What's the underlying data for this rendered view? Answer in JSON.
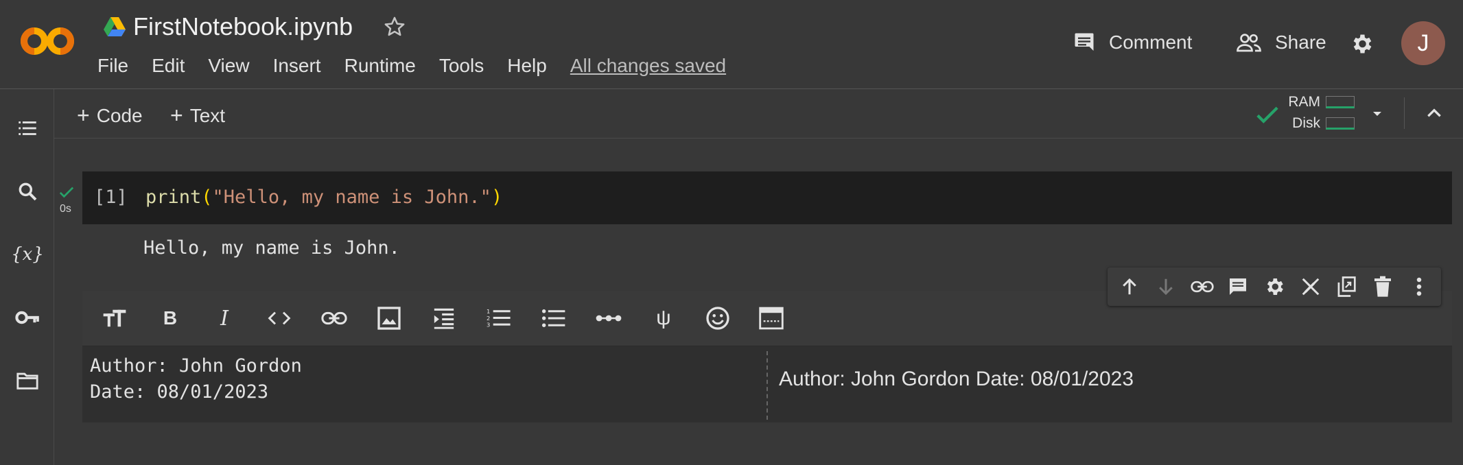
{
  "header": {
    "title": "FirstNotebook.ipynb",
    "menu": [
      "File",
      "Edit",
      "View",
      "Insert",
      "Runtime",
      "Tools",
      "Help"
    ],
    "saved_status": "All changes saved",
    "comment_label": "Comment",
    "share_label": "Share",
    "avatar_initial": "J"
  },
  "toolbar": {
    "code_label": "Code",
    "text_label": "Text",
    "ram_label": "RAM",
    "disk_label": "Disk"
  },
  "code_cell": {
    "exec_count": "[1]",
    "run_time": "0s",
    "code_func": "print",
    "code_open": "(",
    "code_string": "\"Hello, my name is John.\"",
    "code_close": ")",
    "output": "Hello, my name is John."
  },
  "text_cell": {
    "editor_lines": [
      "Author: John Gordon",
      "Date: 08/01/2023"
    ],
    "preview": "Author: John Gordon Date: 08/01/2023"
  },
  "colors": {
    "background": "#383838",
    "code_bg": "#1e1e1e",
    "accent_green": "#26a269",
    "logo_orange": "#f9ab00"
  },
  "icons": {
    "sidebar": [
      "list-icon",
      "search-icon",
      "variables-icon",
      "key-icon",
      "folder-icon"
    ],
    "format_toolbar": [
      "text-size-icon",
      "bold-icon",
      "italic-icon",
      "code-icon",
      "link-icon",
      "image-icon",
      "indent-icon",
      "numbered-list-icon",
      "bullet-list-icon",
      "horizontal-rule-icon",
      "psi-icon",
      "emoji-icon",
      "preview-icon"
    ],
    "cell_actions": [
      "arrow-up-icon",
      "arrow-down-icon",
      "link-icon",
      "comment-icon",
      "gear-icon",
      "edit-off-icon",
      "mirror-cell-icon",
      "delete-icon",
      "more-vert-icon"
    ]
  }
}
